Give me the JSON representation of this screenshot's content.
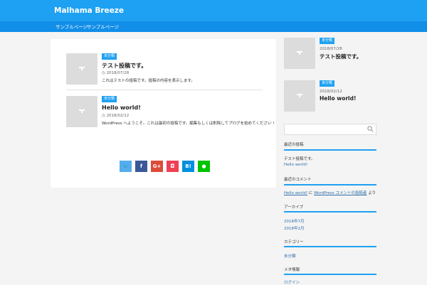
{
  "site": {
    "title": "Malhama Breeze"
  },
  "nav": {
    "items": [
      "サンプルページ",
      "サンプルページ"
    ]
  },
  "colors": {
    "header": "#1ea1f2",
    "nav": "#118ee8",
    "category": "#1ea1f2"
  },
  "posts": [
    {
      "category": "未分類",
      "title": "テスト投稿です。",
      "date": "2018/07/28",
      "excerpt": "これはテストの投稿です。投稿の内容を表示します。"
    },
    {
      "category": "未分類",
      "title": "Hello world!",
      "date": "2018/02/12",
      "excerpt": "WordPress へようこそ。これは最初の投稿です。編集もしくは削除してブログを始めてください !"
    }
  ],
  "share": {
    "buttons": [
      {
        "label": "🐦",
        "icon": "twitter-icon",
        "color": "#55acee"
      },
      {
        "label": "f",
        "icon": "facebook-icon",
        "color": "#3b5998"
      },
      {
        "label": "G+",
        "icon": "google-plus-icon",
        "color": "#dd4b39"
      },
      {
        "label": "◘",
        "icon": "pocket-icon",
        "color": "#ee4056"
      },
      {
        "label": "B!",
        "icon": "hatena-icon",
        "color": "#008fde"
      },
      {
        "label": "●",
        "icon": "line-icon",
        "color": "#00c300"
      }
    ]
  },
  "sidebar": {
    "posts": [
      {
        "category": "未分類",
        "date": "2018/07/28",
        "title": "テスト投稿です。"
      },
      {
        "category": "未分類",
        "date": "2018/02/12",
        "title": "Hello world!"
      }
    ],
    "widgets": {
      "recent_posts": {
        "title": "最近の投稿",
        "items": [
          "テスト投稿です。",
          "Hello world!"
        ]
      },
      "recent_comments": {
        "title": "最近のコメント",
        "link": "Hello world!",
        "middle": "に",
        "author": "WordPress コメントの投稿者",
        "suffix": "より"
      },
      "archives": {
        "title": "アーカイブ",
        "items": [
          "2018年7月",
          "2018年2月"
        ]
      },
      "categories": {
        "title": "カテゴリー",
        "items": [
          "未分類"
        ]
      },
      "meta": {
        "title": "メタ情報",
        "items": [
          "ログイン"
        ]
      }
    }
  }
}
